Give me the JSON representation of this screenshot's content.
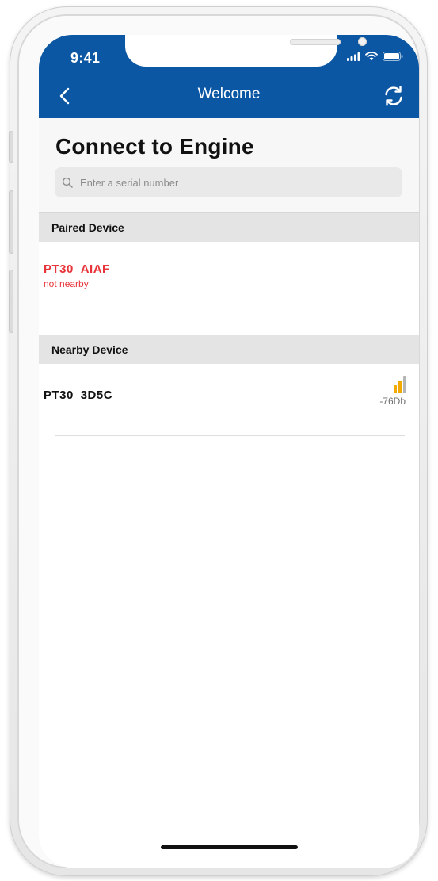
{
  "status_bar": {
    "time": "9:41"
  },
  "nav": {
    "title": "Welcome",
    "back_icon": "chevron-left-icon",
    "refresh_icon": "refresh-icon"
  },
  "main": {
    "title": "Connect to Engine",
    "search": {
      "placeholder": "Enter a serial number",
      "value": ""
    },
    "paired_section": {
      "header": "Paired Device",
      "device": {
        "name": "PT30_AIAF",
        "status": "not nearby"
      }
    },
    "nearby_section": {
      "header": "Nearby Device",
      "devices": [
        {
          "name": "PT30_3D5C",
          "signal": "-76Db",
          "signal_level_bars": 2,
          "signal_max_bars": 3
        }
      ]
    }
  },
  "colors": {
    "brand_blue": "#0b57a4",
    "paired_red": "#e8353b",
    "signal_active": "#f2a900",
    "signal_inactive": "#b5b5b5"
  }
}
